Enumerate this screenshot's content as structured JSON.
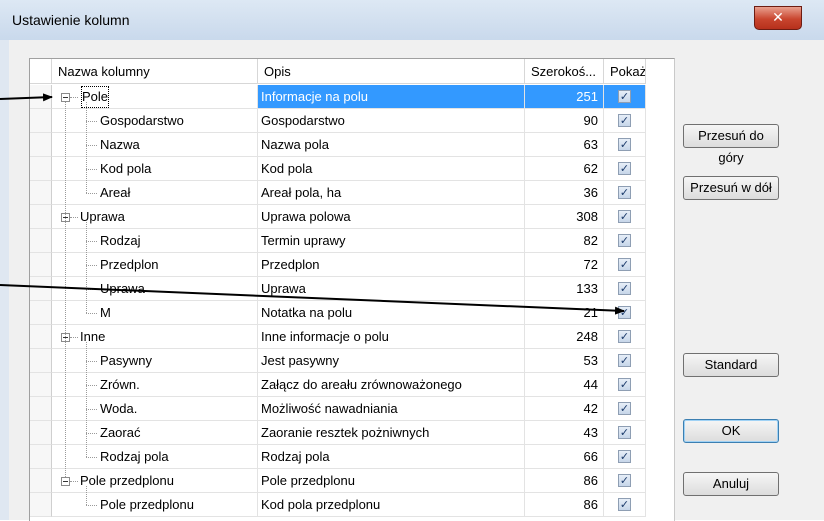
{
  "window": {
    "title": "Ustawienie kolumn",
    "close_glyph": "✕"
  },
  "grid": {
    "headers": {
      "name": "Nazwa kolumny",
      "opis": "Opis",
      "szer": "Szerokoś...",
      "pokaz": "Pokaż"
    },
    "rows": [
      {
        "name": "Pole",
        "opis": "Informacje na polu",
        "szer": "251",
        "level": 0,
        "selected": true
      },
      {
        "name": "Gospodarstwo",
        "opis": "Gospodarstwo",
        "szer": "90",
        "level": 1
      },
      {
        "name": "Nazwa",
        "opis": "Nazwa pola",
        "szer": "63",
        "level": 1
      },
      {
        "name": "Kod pola",
        "opis": "Kod pola",
        "szer": "62",
        "level": 1
      },
      {
        "name": "Areał",
        "opis": "Areał pola, ha",
        "szer": "36",
        "level": 1
      },
      {
        "name": "Uprawa",
        "opis": "Uprawa polowa",
        "szer": "308",
        "level": 0
      },
      {
        "name": "Rodzaj",
        "opis": "Termin uprawy",
        "szer": "82",
        "level": 1
      },
      {
        "name": "Przedplon",
        "opis": "Przedplon",
        "szer": "72",
        "level": 1
      },
      {
        "name": "Uprawa",
        "opis": "Uprawa",
        "szer": "133",
        "level": 1
      },
      {
        "name": "M",
        "opis": "Notatka na polu",
        "szer": "21",
        "level": 1
      },
      {
        "name": "Inne",
        "opis": "Inne informacje o polu",
        "szer": "248",
        "level": 0
      },
      {
        "name": "Pasywny",
        "opis": "Jest pasywny",
        "szer": "53",
        "level": 1
      },
      {
        "name": "Zrówn.",
        "opis": "Załącz do areału zrównoważonego",
        "szer": "44",
        "level": 1
      },
      {
        "name": "Woda.",
        "opis": "Możliwość nawadniania",
        "szer": "42",
        "level": 1
      },
      {
        "name": "Zaorać",
        "opis": "Zaoranie resztek pożniwnych",
        "szer": "43",
        "level": 1
      },
      {
        "name": "Rodzaj pola",
        "opis": "Rodzaj pola",
        "szer": "66",
        "level": 1
      },
      {
        "name": "Pole przedplonu",
        "opis": "Pole przedplonu",
        "szer": "86",
        "level": 0
      },
      {
        "name": "Pole przedplonu",
        "opis": "Kod pola przedplonu",
        "szer": "86",
        "level": 1
      }
    ],
    "check_glyph": "✓",
    "expander_icon": "minus-box-icon"
  },
  "buttons": {
    "move_up": "Przesuń do góry",
    "move_down": "Przesuń w dół",
    "standard": "Standard",
    "ok": "OK",
    "cancel": "Anuluj"
  },
  "colors": {
    "selection": "#3399ff",
    "close": "#c9452e"
  }
}
